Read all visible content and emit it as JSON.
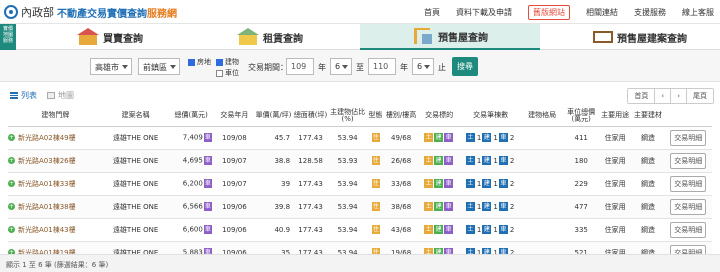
{
  "header": {
    "ministry": "內政部",
    "site_title": "不動產交易實價查詢",
    "site_suffix": "服務網",
    "nav": [
      "首頁",
      "資料下載及申請",
      "舊版網站",
      "相關連結",
      "支援服務",
      "線上客服"
    ]
  },
  "side_button": "實價\n地圖\n服務",
  "tabs": [
    {
      "label": "買賣查詢",
      "active": false
    },
    {
      "label": "租賃查詢",
      "active": false
    },
    {
      "label": "預售屋查詢",
      "active": true
    },
    {
      "label": "預售屋建案查詢",
      "active": false
    }
  ],
  "search": {
    "city": "高雄市",
    "district": "前鎮區",
    "chk_land": "房地",
    "chk_building": "建物",
    "chk_lot": "車位",
    "period_label": "交易期間：",
    "from_year": "109",
    "year_unit": "年",
    "from_month": "6",
    "to_label": "至",
    "to_year": "110",
    "to_month": "6",
    "month_unit": "止",
    "search_button": "搜尋"
  },
  "views": {
    "list": "列表",
    "map": "地圖"
  },
  "pager": {
    "first": "首頁",
    "prev": "‹",
    "next": "›",
    "last": "尾頁"
  },
  "columns": [
    "建物門牌",
    "建案名稱",
    "總價(萬元)",
    "交易年月",
    "單價(萬/坪)",
    "總面積(坪)",
    "主建物佔比(%)",
    "型態",
    "樓別/樓高",
    "交易標的",
    "交易筆棟數",
    "建物格局",
    "車位總價(萬元)",
    "主要用途",
    "主要建材",
    ""
  ],
  "rows": [
    {
      "addr": "新光路A02棟49樓",
      "project": "遠雄THE ONE",
      "price": "7,409",
      "ym": "109/08",
      "unit": "45.7",
      "area": "177.43",
      "ratio": "53.94",
      "floor": "49/68",
      "lot_price": "411",
      "use": "住家用",
      "material": "鋼造",
      "detail": "交易明細"
    },
    {
      "addr": "新光路A03棟26樓",
      "project": "遠雄THE ONE",
      "price": "4,695",
      "ym": "109/07",
      "unit": "38.8",
      "area": "128.58",
      "ratio": "53.93",
      "floor": "26/68",
      "lot_price": "180",
      "use": "住家用",
      "material": "鋼造",
      "detail": "交易明細"
    },
    {
      "addr": "新光路A01棟33樓",
      "project": "遠雄THE ONE",
      "price": "6,200",
      "ym": "109/07",
      "unit": "39",
      "area": "177.43",
      "ratio": "53.94",
      "floor": "33/68",
      "lot_price": "229",
      "use": "住家用",
      "material": "鋼造",
      "detail": "交易明細"
    },
    {
      "addr": "新光路A01棟38樓",
      "project": "遠雄THE ONE",
      "price": "6,566",
      "ym": "109/06",
      "unit": "39.8",
      "area": "177.43",
      "ratio": "53.94",
      "floor": "38/68",
      "lot_price": "477",
      "use": "住家用",
      "material": "鋼造",
      "detail": "交易明細"
    },
    {
      "addr": "新光路A01棟43樓",
      "project": "遠雄THE ONE",
      "price": "6,600",
      "ym": "109/06",
      "unit": "40.9",
      "area": "177.43",
      "ratio": "53.94",
      "floor": "43/68",
      "lot_price": "335",
      "use": "住家用",
      "material": "鋼造",
      "detail": "交易明細"
    },
    {
      "addr": "新光路A01棟19樓",
      "project": "遠雄THE ONE",
      "price": "5,883",
      "ym": "109/06",
      "unit": "35",
      "area": "177.43",
      "ratio": "53.94",
      "floor": "19/68",
      "lot_price": "521",
      "use": "住家用",
      "material": "鋼造",
      "detail": "交易明細"
    }
  ],
  "badges": {
    "price_badge": "車",
    "type_badge": "住",
    "target": [
      "土",
      "建",
      "車"
    ],
    "count": [
      "土",
      "1",
      "建",
      "1",
      "車",
      "2"
    ]
  },
  "footer": "顯示 1 至 6 筆 (篩選結果：6 筆)",
  "colors": {
    "brand": "#1f6fb5",
    "accent": "#1e8a7d",
    "orange": "#e67e22"
  }
}
